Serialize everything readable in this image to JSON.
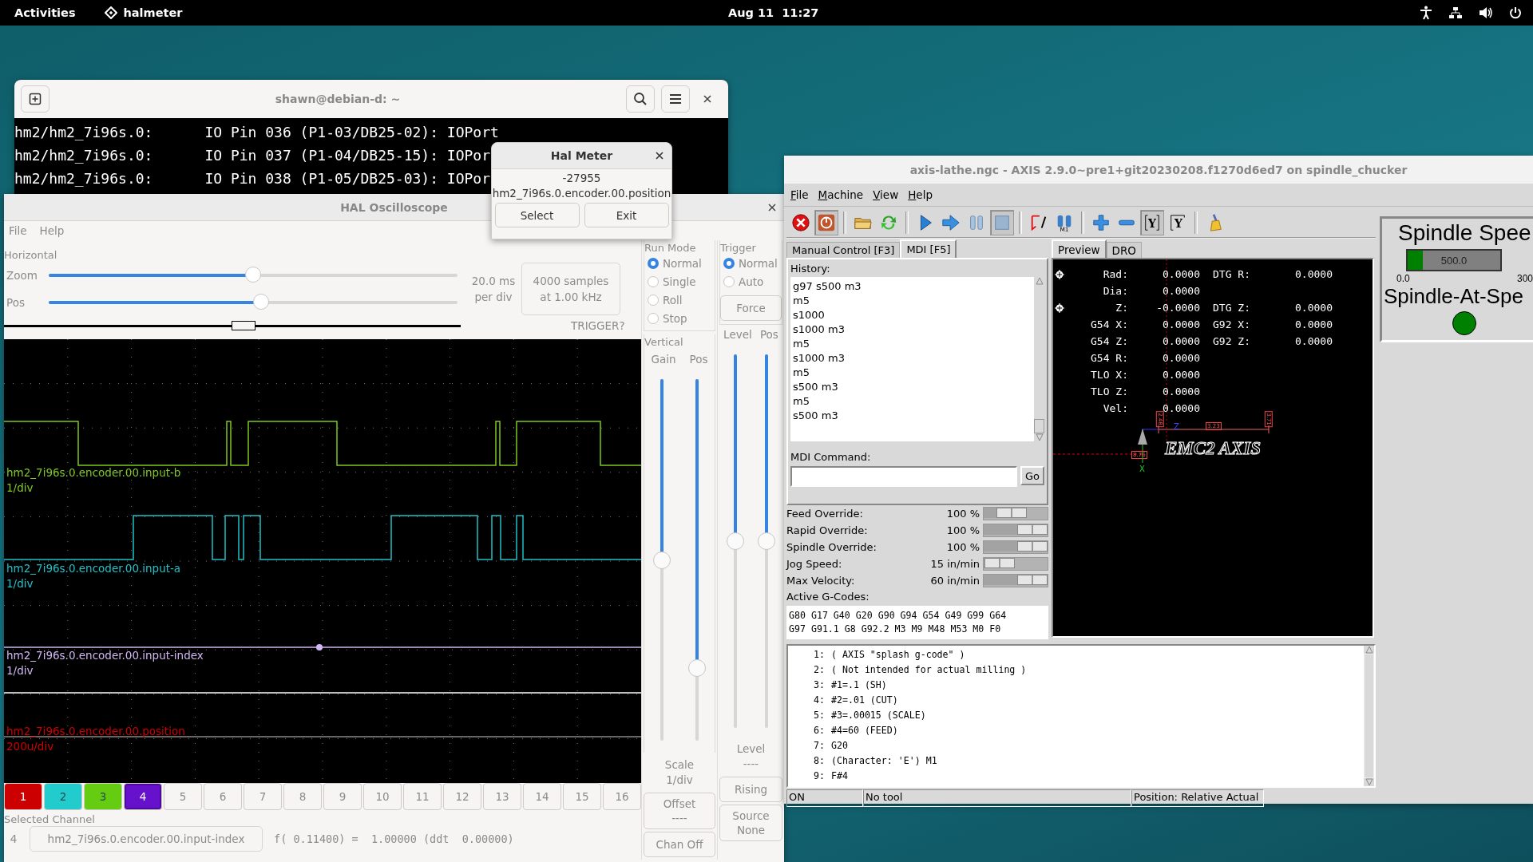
{
  "topbar": {
    "activities": "Activities",
    "app": "halmeter",
    "clock": "Aug 11  11:27"
  },
  "terminal": {
    "title": "shawn@debian-d: ~",
    "lines": [
      "hm2/hm2_7i96s.0:      IO Pin 036 (P1-03/DB25-02): IOPort",
      "hm2/hm2_7i96s.0:      IO Pin 037 (P1-04/DB25-15): IOPor",
      "hm2/hm2_7i96s.0:      IO Pin 038 (P1-05/DB25-03): IOPor"
    ]
  },
  "halmeter": {
    "title": "Hal Meter",
    "value": "-27955",
    "pin": "hm2_7i96s.0.encoder.00.position",
    "buttons": [
      "Select",
      "Exit"
    ]
  },
  "scope": {
    "title": "HAL Oscilloscope",
    "menu": [
      "File",
      "Help"
    ],
    "horizontal": {
      "legend": "Horizontal",
      "sliders": [
        {
          "label": "Zoom",
          "level": 0.5
        },
        {
          "label": "Pos",
          "level": 0.52
        }
      ],
      "rate": [
        "20.0 ms",
        "per div"
      ],
      "samples": [
        "4000 samples",
        "at 1.00 kHz"
      ],
      "trigger_status": "TRIGGER?"
    },
    "traces": [
      {
        "name": "hm2_7i96s.0.encoder.00.input-b",
        "scale": "1/div",
        "color": "#80c820"
      },
      {
        "name": "hm2_7i96s.0.encoder.00.input-a",
        "scale": "1/div",
        "color": "#20c0c8"
      },
      {
        "name": "hm2_7i96s.0.encoder.00.input-index",
        "scale": "1/div",
        "color": "#d0b8f0"
      },
      {
        "name": "hm2_7i96s.0.encoder.00.position",
        "scale": "200u/div",
        "color": "#cc0000"
      }
    ],
    "channels": [
      {
        "label": "1",
        "color": "#cc0000",
        "selected": false
      },
      {
        "label": "2",
        "color": "#22cccc",
        "selected": false
      },
      {
        "label": "3",
        "color": "#66cc11",
        "selected": false
      },
      {
        "label": "4",
        "color": "#6611cc",
        "selected": true
      },
      {
        "label": "5",
        "selected": false
      },
      {
        "label": "6",
        "selected": false
      },
      {
        "label": "7",
        "selected": false
      },
      {
        "label": "8",
        "selected": false
      },
      {
        "label": "9",
        "selected": false
      },
      {
        "label": "10",
        "selected": false
      },
      {
        "label": "11",
        "selected": false
      },
      {
        "label": "12",
        "selected": false
      },
      {
        "label": "13",
        "selected": false
      },
      {
        "label": "14",
        "selected": false
      },
      {
        "label": "15",
        "selected": false
      },
      {
        "label": "16",
        "selected": false
      }
    ],
    "selected_channel": {
      "legend": "Selected Channel",
      "number": "4",
      "name": "hm2_7i96s.0.encoder.00.input-index",
      "readout": "f( 0.11400) =  1.00000 (ddt  0.00000)"
    },
    "run_mode": {
      "legend": "Run Mode",
      "options": [
        {
          "label": "Normal",
          "selected": true
        },
        {
          "label": "Single",
          "selected": false
        },
        {
          "label": "Roll",
          "selected": false
        },
        {
          "label": "Stop",
          "selected": false
        }
      ]
    },
    "vertical": {
      "legend": "Vertical",
      "sliders": [
        {
          "label": "Gain",
          "level": 0.5
        },
        {
          "label": "Pos",
          "level": 0.8
        }
      ],
      "scale": [
        "Scale",
        "1/div"
      ],
      "offset": [
        "Offset",
        "----"
      ],
      "chan_off": "Chan Off"
    },
    "trigger": {
      "legend": "Trigger",
      "options": [
        {
          "label": "Normal",
          "selected": true
        },
        {
          "label": "Auto",
          "selected": false
        }
      ],
      "force": "Force",
      "sliders": [
        {
          "label": "Level",
          "level": 0.5
        },
        {
          "label": "Pos",
          "level": 0.5
        }
      ],
      "level_readout": [
        "Level",
        "----"
      ],
      "edge": "Rising",
      "source": [
        "Source",
        "None"
      ]
    }
  },
  "axis": {
    "title": "axis-lathe.ngc - AXIS 2.9.0~pre1+git20230208.f1270d6ed7 on spindle_chucker",
    "menu": [
      "File",
      "Machine",
      "View",
      "Help"
    ],
    "toolbar": [
      {
        "kind": "estop",
        "pressed": false
      },
      {
        "kind": "power",
        "pressed": true
      },
      {
        "kind": "separator"
      },
      {
        "kind": "open",
        "pressed": false
      },
      {
        "kind": "reload",
        "pressed": false
      },
      {
        "kind": "separator"
      },
      {
        "kind": "run",
        "pressed": false
      },
      {
        "kind": "step",
        "pressed": false
      },
      {
        "kind": "pause",
        "pressed": false
      },
      {
        "kind": "stop",
        "pressed": true
      },
      {
        "kind": "separator"
      },
      {
        "kind": "blockdelete",
        "pressed": false
      },
      {
        "kind": "optstop",
        "label": "M1",
        "pressed": false
      },
      {
        "kind": "separator"
      },
      {
        "kind": "zoomin",
        "pressed": false
      },
      {
        "kind": "zoomout",
        "pressed": false
      },
      {
        "kind": "viewtop",
        "label": "Y",
        "pressed": true
      },
      {
        "kind": "viewrot",
        "label": "Y",
        "pressed": false
      },
      {
        "kind": "separator"
      },
      {
        "kind": "clear",
        "pressed": false
      }
    ],
    "tabs": [
      {
        "label": "Manual Control [F3]",
        "selected": false
      },
      {
        "label": "MDI [F5]",
        "selected": true
      }
    ],
    "history_label": "History:",
    "history": [
      "g97 s500 m3",
      "m5",
      "s1000",
      "s1000 m3",
      "m5",
      "s1000 m3",
      "m5",
      "s500 m3",
      "m5",
      "s500 m3"
    ],
    "mdi_label": "MDI Command:",
    "go": "Go",
    "overrides": [
      {
        "label": "Feed Override:",
        "value": "100 %",
        "level": 0.68
      },
      {
        "label": "Rapid Override:",
        "value": "100 %",
        "level": 1
      },
      {
        "label": "Spindle Override:",
        "value": "100 %",
        "level": 1
      },
      {
        "label": "Jog Speed:",
        "value": "15 in/min",
        "level": 0.49
      },
      {
        "label": "Max Velocity:",
        "value": "60 in/min",
        "level": 1
      }
    ],
    "gcodes_label": "Active G-Codes:",
    "gcodes": [
      "G80 G17 G40 G20 G90 G94 G54 G49 G99 G64",
      "G97 G91.1 G8 G92.2 M3 M9 M48 M53 M0 F0"
    ],
    "preview_tabs": [
      {
        "label": "Preview",
        "selected": true
      },
      {
        "label": "DRO",
        "selected": false
      }
    ],
    "dro": [
      {
        "label": "Rad:",
        "value": "0.0000",
        "label2": "DTG R:",
        "value2": "0.0000",
        "homed": true
      },
      {
        "label": "Dia:",
        "value": "0.0000",
        "homed": false
      },
      {
        "label": "Z:",
        "value": "-0.0000",
        "label2": "DTG Z:",
        "value2": "0.0000",
        "homed": true
      },
      {
        "label": "G54 X:",
        "value": "0.0000",
        "label2": "G92 X:",
        "value2": "0.0000",
        "homed": false
      },
      {
        "label": "G54 Z:",
        "value": "0.0000",
        "label2": "G92 Z:",
        "value2": "0.0000",
        "homed": false
      },
      {
        "label": "G54 R:",
        "value": "0.0000",
        "homed": false
      },
      {
        "label": "TLO X:",
        "value": "0.0000",
        "homed": false
      },
      {
        "label": "TLO Z:",
        "value": "0.0000",
        "homed": false
      },
      {
        "label": "Vel:",
        "value": "0.0000",
        "homed": false
      }
    ],
    "preview": {
      "logo": "EMC2 AXIS",
      "axis_z": "Z",
      "axis_x": "X",
      "dims": [
        "3.23",
        "3.71",
        "2.48",
        "8.76"
      ]
    },
    "spindle": {
      "title": "Spindle Spee",
      "value": "500.0",
      "level": 0.167,
      "min": "0.0",
      "max": "300",
      "at_speed_label": "Spindle-At-Spe",
      "at_speed": true
    },
    "program": [
      {
        "n": "1:",
        "text": "( AXIS \"splash g-code\" )"
      },
      {
        "n": "2:",
        "text": "( Not intended for actual milling )"
      },
      {
        "n": "3:",
        "text": "#1=.1 (SH)"
      },
      {
        "n": "4:",
        "text": "#2=.01 (CUT)"
      },
      {
        "n": "5:",
        "text": "#3=.00015 (SCALE)"
      },
      {
        "n": "6:",
        "text": "#4=60 (FEED)"
      },
      {
        "n": "7:",
        "text": "G20"
      },
      {
        "n": "8:",
        "text": "(Character: 'E') M1"
      },
      {
        "n": "9:",
        "text": "F#4"
      }
    ],
    "status": [
      "ON",
      "No tool",
      "Position: Relative Actual"
    ]
  }
}
